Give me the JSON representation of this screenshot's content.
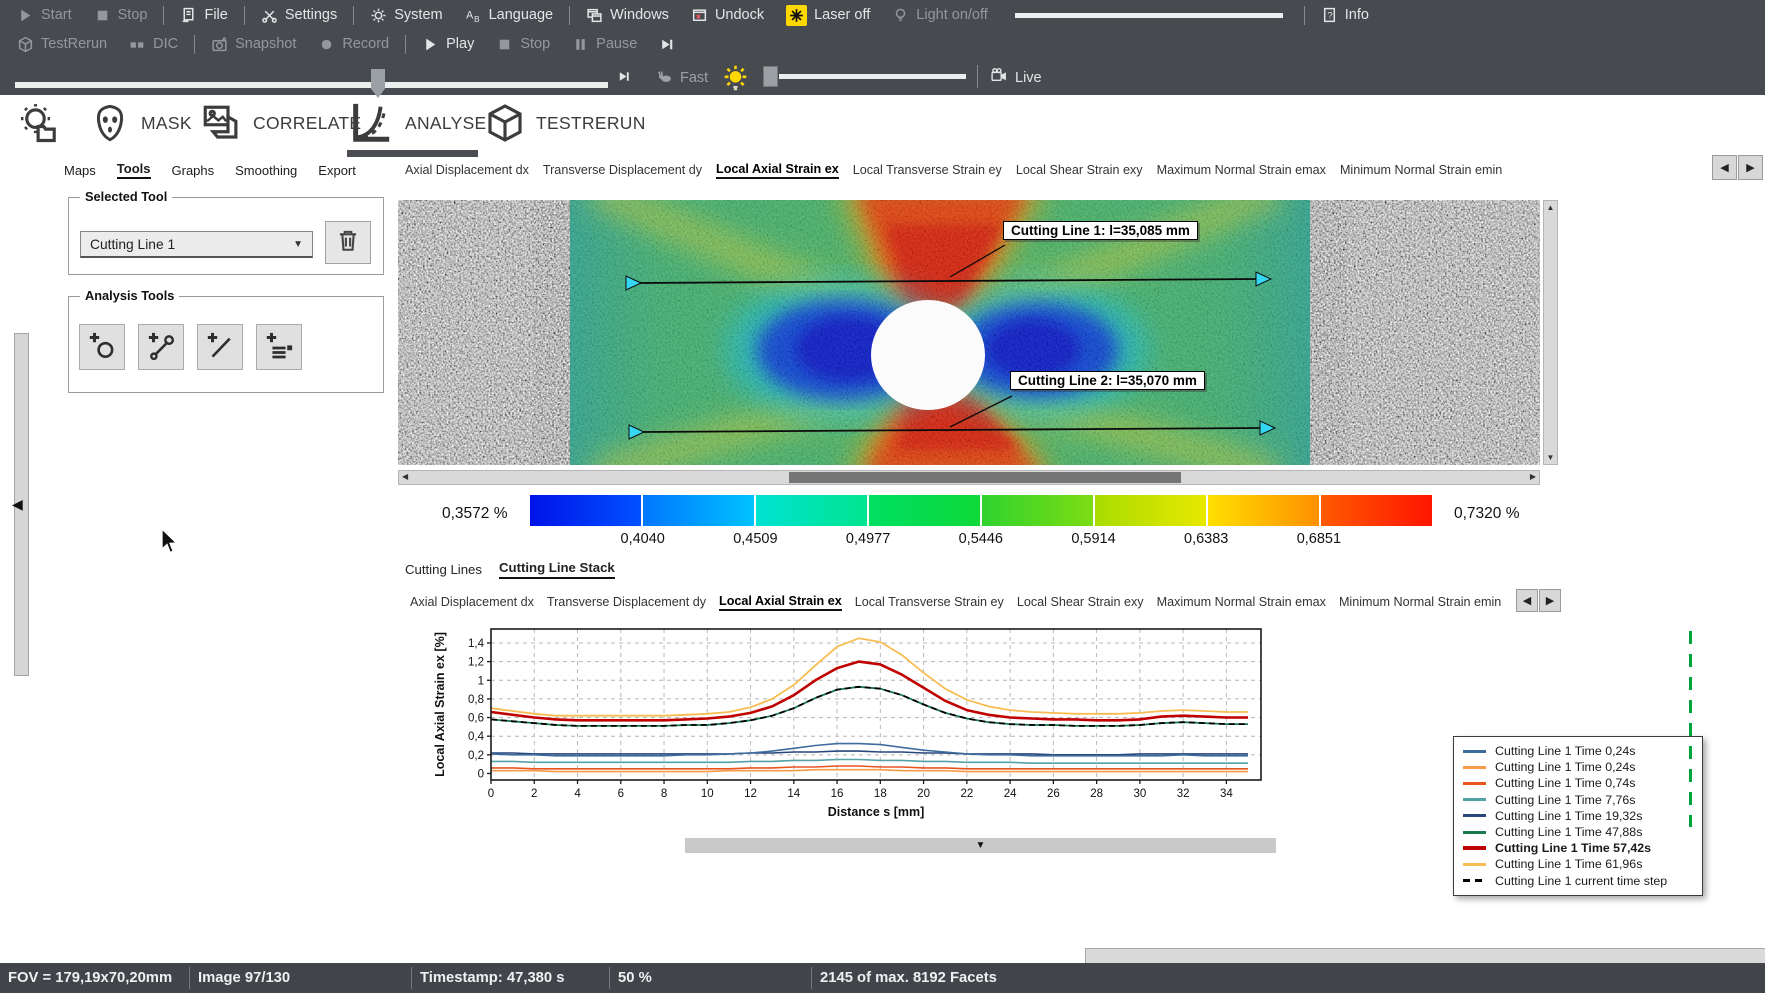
{
  "toolbar_row1": [
    {
      "type": "item",
      "name": "start",
      "icon": "play",
      "label": "Start",
      "enabled": false
    },
    {
      "type": "item",
      "name": "stop",
      "icon": "stop",
      "label": "Stop",
      "enabled": false
    },
    {
      "type": "sep"
    },
    {
      "type": "item",
      "name": "file",
      "icon": "file",
      "label": "File",
      "enabled": true
    },
    {
      "type": "sep"
    },
    {
      "type": "item",
      "name": "settings",
      "icon": "settings",
      "label": "Settings",
      "enabled": true
    },
    {
      "type": "sep"
    },
    {
      "type": "item",
      "name": "system",
      "icon": "gear",
      "label": "System",
      "enabled": true
    },
    {
      "type": "item",
      "name": "language",
      "icon": "language",
      "label": "Language",
      "enabled": true
    },
    {
      "type": "sep"
    },
    {
      "type": "item",
      "name": "windows",
      "icon": "windows",
      "label": "Windows",
      "enabled": true
    },
    {
      "type": "item",
      "name": "undock",
      "icon": "undock",
      "label": "Undock",
      "enabled": true
    },
    {
      "type": "item",
      "name": "laser-off",
      "icon": "laser",
      "label": "Laser off",
      "enabled": true,
      "accent": true
    },
    {
      "type": "item",
      "name": "light-on-off",
      "icon": "bulb-outline",
      "label": "Light on/off",
      "enabled": false
    },
    {
      "type": "slider",
      "name": "light-intensity-slider"
    },
    {
      "type": "sep"
    },
    {
      "type": "item",
      "name": "info",
      "icon": "info",
      "label": "Info",
      "enabled": true
    }
  ],
  "toolbar_row2": [
    {
      "type": "item",
      "name": "testrerun",
      "icon": "box",
      "label": "TestRerun",
      "enabled": false
    },
    {
      "type": "item",
      "name": "dic",
      "icon": "dic",
      "label": "DIC",
      "enabled": false
    },
    {
      "type": "sep"
    },
    {
      "type": "item",
      "name": "snapshot",
      "icon": "snapshot",
      "label": "Snapshot",
      "enabled": false
    },
    {
      "type": "item",
      "name": "record",
      "icon": "record",
      "label": "Record",
      "enabled": false
    },
    {
      "type": "sep"
    },
    {
      "type": "item",
      "name": "play",
      "icon": "play",
      "label": "Play",
      "enabled": true
    },
    {
      "type": "item",
      "name": "stop2",
      "icon": "stop",
      "label": "Stop",
      "enabled": false
    },
    {
      "type": "item",
      "name": "pause",
      "icon": "pause",
      "label": "Pause",
      "enabled": false
    },
    {
      "type": "item",
      "name": "step-end",
      "icon": "step",
      "label": "",
      "enabled": true
    }
  ],
  "playback": {
    "fast_label": "Fast",
    "live_label": "Live"
  },
  "ribbon": {
    "items": [
      "MASK",
      "CORRELATE",
      "ANALYSE",
      "TESTRERUN"
    ],
    "active_index": 2
  },
  "side_tabs": {
    "items": [
      "Maps",
      "Tools",
      "Graphs",
      "Smoothing",
      "Export"
    ],
    "active_index": 1
  },
  "map_tabs": {
    "items": [
      "Axial Displacement dx",
      "Transverse Displacement dy",
      "Local Axial Strain ex",
      "Local Transverse Strain ey",
      "Local Shear Strain exy",
      "Maximum Normal Strain emax",
      "Minimum Normal Strain emin"
    ],
    "active_index": 2
  },
  "selected_tool": {
    "group_label": "Selected Tool",
    "value": "Cutting Line 1"
  },
  "analysis_tools": {
    "group_label": "Analysis Tools"
  },
  "map_view": {
    "annotations": [
      {
        "label": "Cutting Line 1: l=35,085 mm"
      },
      {
        "label": "Cutting Line 2: l=35,070 mm"
      }
    ]
  },
  "color_scale": {
    "min_label": "0,3572 %",
    "max_label": "0,7320 %",
    "tick_labels": [
      "0,4040",
      "0,4509",
      "0,4977",
      "0,5446",
      "0,5914",
      "0,6383",
      "0,6851"
    ],
    "segments": [
      [
        "#0013e8",
        "#0051ff"
      ],
      [
        "#0077ff",
        "#00c3ff"
      ],
      [
        "#00e2d2",
        "#00e590"
      ],
      [
        "#00df63",
        "#0fd938"
      ],
      [
        "#2fd32f",
        "#7ddc12"
      ],
      [
        "#a8dc00",
        "#e8e800"
      ],
      [
        "#ffdf00",
        "#ff9000"
      ],
      [
        "#ff5a00",
        "#ff1500"
      ]
    ]
  },
  "bottom_tabs": {
    "items": [
      "Cutting Lines",
      "Cutting Line Stack"
    ],
    "active_index": 1
  },
  "chart_tabs": {
    "items": [
      "Axial Displacement dx",
      "Transverse Displacement dy",
      "Local Axial Strain ex",
      "Local Transverse Strain ey",
      "Local Shear Strain exy",
      "Maximum Normal Strain emax",
      "Minimum Normal Strain emin"
    ],
    "active_index": 2
  },
  "chart_data": {
    "type": "line",
    "title": "",
    "xlabel": "Distance s [mm]",
    "ylabel": "Local Axial Strain ex [%]",
    "xlim": [
      0,
      35.6
    ],
    "ylim": [
      -0.07,
      1.55
    ],
    "xticks": [
      0,
      2,
      4,
      6,
      8,
      10,
      12,
      14,
      16,
      18,
      20,
      22,
      24,
      26,
      28,
      30,
      32,
      34
    ],
    "yticks": [
      0,
      0.2,
      0.4,
      0.6,
      0.8,
      1,
      1.2,
      1.4
    ],
    "ytick_labels": [
      "0",
      "0,2",
      "0,4",
      "0,6",
      "0,8",
      "1",
      "1,2",
      "1,4"
    ],
    "grid": "dashed",
    "legend_position": "right",
    "draw_order": [
      1,
      2,
      3,
      4,
      0,
      5,
      8,
      6,
      7
    ],
    "x": [
      0,
      1,
      2,
      3,
      4,
      5,
      6,
      7,
      8,
      9,
      10,
      11,
      12,
      13,
      14,
      15,
      16,
      17,
      18,
      19,
      20,
      21,
      22,
      23,
      24,
      25,
      26,
      27,
      28,
      29,
      30,
      31,
      32,
      33,
      34,
      35
    ],
    "series": [
      {
        "name": "Cutting Line 1 Time 0,24s",
        "color": "#3f6e9e",
        "width": 1.6,
        "values": [
          0.21,
          0.2,
          0.2,
          0.19,
          0.19,
          0.19,
          0.19,
          0.19,
          0.19,
          0.2,
          0.2,
          0.21,
          0.22,
          0.24,
          0.27,
          0.3,
          0.32,
          0.32,
          0.31,
          0.28,
          0.25,
          0.23,
          0.21,
          0.2,
          0.2,
          0.19,
          0.19,
          0.19,
          0.19,
          0.19,
          0.19,
          0.19,
          0.2,
          0.19,
          0.19,
          0.19
        ]
      },
      {
        "name": "Cutting Line 1 Time 0,24s",
        "color": "#f79b4a",
        "width": 1.6,
        "values": [
          0.03,
          0.03,
          0.03,
          0.02,
          0.02,
          0.02,
          0.02,
          0.02,
          0.02,
          0.02,
          0.02,
          0.03,
          0.03,
          0.03,
          0.03,
          0.04,
          0.04,
          0.04,
          0.04,
          0.03,
          0.03,
          0.03,
          0.02,
          0.02,
          0.02,
          0.02,
          0.02,
          0.02,
          0.02,
          0.02,
          0.02,
          0.02,
          0.02,
          0.02,
          0.02,
          0.02
        ]
      },
      {
        "name": "Cutting Line 1 Time 0,74s",
        "color": "#e8531e",
        "width": 1.6,
        "values": [
          0.06,
          0.06,
          0.05,
          0.05,
          0.05,
          0.05,
          0.05,
          0.05,
          0.05,
          0.05,
          0.05,
          0.05,
          0.06,
          0.06,
          0.07,
          0.07,
          0.08,
          0.08,
          0.07,
          0.07,
          0.06,
          0.06,
          0.05,
          0.05,
          0.05,
          0.05,
          0.05,
          0.05,
          0.05,
          0.05,
          0.05,
          0.05,
          0.05,
          0.05,
          0.05,
          0.05
        ]
      },
      {
        "name": "Cutting Line 1 Time 7,76s",
        "color": "#55a1a8",
        "width": 1.6,
        "values": [
          0.13,
          0.13,
          0.12,
          0.12,
          0.12,
          0.12,
          0.12,
          0.12,
          0.12,
          0.12,
          0.12,
          0.12,
          0.13,
          0.13,
          0.14,
          0.14,
          0.15,
          0.15,
          0.14,
          0.14,
          0.13,
          0.13,
          0.12,
          0.12,
          0.12,
          0.11,
          0.11,
          0.11,
          0.11,
          0.11,
          0.11,
          0.11,
          0.11,
          0.11,
          0.11,
          0.11
        ]
      },
      {
        "name": "Cutting Line 1 Time 19,32s",
        "color": "#27477d",
        "width": 1.6,
        "values": [
          0.22,
          0.22,
          0.21,
          0.21,
          0.21,
          0.21,
          0.21,
          0.21,
          0.21,
          0.21,
          0.21,
          0.21,
          0.22,
          0.22,
          0.23,
          0.23,
          0.24,
          0.24,
          0.23,
          0.23,
          0.22,
          0.22,
          0.21,
          0.21,
          0.21,
          0.21,
          0.2,
          0.2,
          0.2,
          0.2,
          0.21,
          0.21,
          0.21,
          0.21,
          0.21,
          0.21
        ]
      },
      {
        "name": "Cutting Line 1 Time 47,88s",
        "color": "#1a7a4e",
        "width": 1.8,
        "values": [
          0.58,
          0.56,
          0.54,
          0.52,
          0.51,
          0.51,
          0.51,
          0.51,
          0.51,
          0.52,
          0.52,
          0.54,
          0.57,
          0.62,
          0.7,
          0.81,
          0.9,
          0.93,
          0.91,
          0.84,
          0.74,
          0.65,
          0.59,
          0.55,
          0.53,
          0.52,
          0.52,
          0.51,
          0.51,
          0.51,
          0.52,
          0.54,
          0.55,
          0.54,
          0.53,
          0.53
        ]
      },
      {
        "name": "Cutting Line 1 Time 57,42s",
        "color": "#c00000",
        "width": 2.6,
        "bold": true,
        "values": [
          0.66,
          0.63,
          0.6,
          0.58,
          0.57,
          0.57,
          0.57,
          0.57,
          0.57,
          0.58,
          0.59,
          0.61,
          0.65,
          0.72,
          0.84,
          1.0,
          1.13,
          1.2,
          1.17,
          1.06,
          0.92,
          0.78,
          0.68,
          0.63,
          0.6,
          0.59,
          0.58,
          0.58,
          0.57,
          0.57,
          0.58,
          0.61,
          0.62,
          0.61,
          0.6,
          0.6
        ]
      },
      {
        "name": "Cutting Line 1 Time 61,96s",
        "color": "#f8bd52",
        "width": 1.8,
        "values": [
          0.7,
          0.67,
          0.64,
          0.62,
          0.62,
          0.62,
          0.62,
          0.62,
          0.62,
          0.63,
          0.64,
          0.66,
          0.71,
          0.8,
          0.95,
          1.16,
          1.36,
          1.45,
          1.41,
          1.27,
          1.08,
          0.91,
          0.79,
          0.72,
          0.68,
          0.66,
          0.65,
          0.64,
          0.64,
          0.64,
          0.65,
          0.67,
          0.68,
          0.67,
          0.66,
          0.66
        ]
      },
      {
        "name": "Cutting Line 1 current time step",
        "color": "#000000",
        "width": 1.8,
        "dash": [
          6,
          4
        ],
        "values": [
          0.58,
          0.56,
          0.54,
          0.52,
          0.51,
          0.51,
          0.51,
          0.51,
          0.51,
          0.52,
          0.52,
          0.54,
          0.57,
          0.62,
          0.7,
          0.81,
          0.9,
          0.93,
          0.91,
          0.84,
          0.74,
          0.65,
          0.59,
          0.55,
          0.53,
          0.52,
          0.52,
          0.51,
          0.51,
          0.51,
          0.52,
          0.54,
          0.55,
          0.54,
          0.53,
          0.53
        ]
      }
    ]
  },
  "statusbar": {
    "items": [
      "FOV = 179,19x70,20mm",
      "Image 97/130",
      "Timestamp: 47,380 s",
      "50 %",
      "2145 of max. 8192 Facets"
    ]
  }
}
